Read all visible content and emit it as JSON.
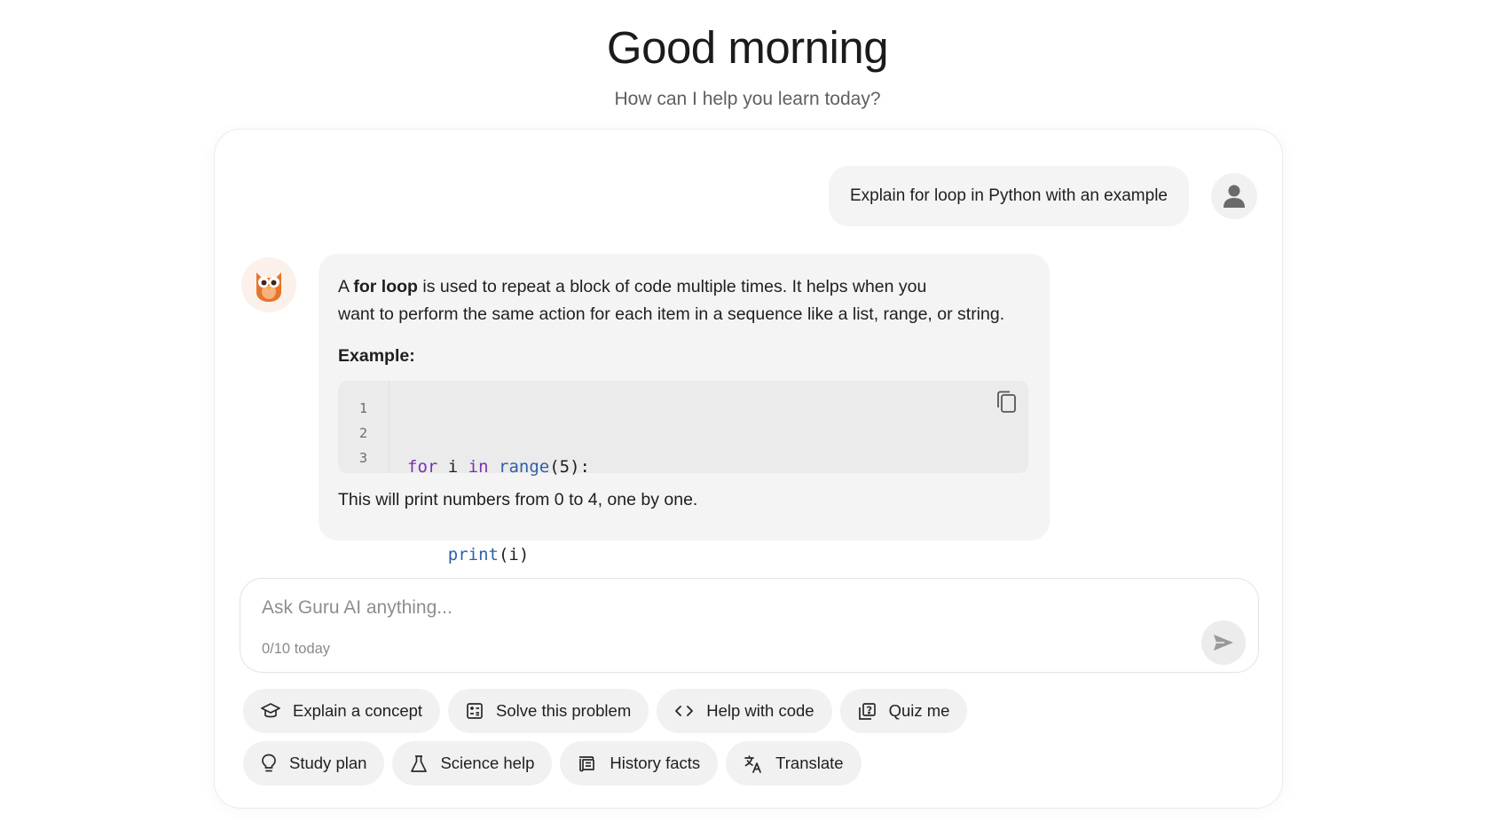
{
  "header": {
    "greeting": "Good morning",
    "subtitle": "How can I help you learn today?"
  },
  "conversation": {
    "user_message": "Explain for loop in Python with an example",
    "assistant": {
      "intro_prefix": "A ",
      "intro_bold": "for loop",
      "intro_rest_line1": " is used to repeat a block of code multiple times. It helps when you",
      "intro_line2": "want to perform the same action for each item in a sequence like a list, range, or string.",
      "example_label": "Example:",
      "code": {
        "line_numbers": [
          "1",
          "2",
          "3"
        ],
        "line1": {
          "kw1": "for",
          "t1": " i ",
          "kw2": "in",
          "t2": " ",
          "fn": "range",
          "t3": "(5):"
        },
        "line2": {
          "indent": "    ",
          "fn": "print",
          "t1": "(i)"
        }
      },
      "outro": "This will print numbers from 0 to 4, one by one."
    }
  },
  "composer": {
    "placeholder": "Ask Guru AI anything...",
    "counter": "0/10 today"
  },
  "quick_actions": {
    "row1": [
      {
        "label": "Explain a concept",
        "icon": "graduation-cap-icon"
      },
      {
        "label": "Solve this problem",
        "icon": "calculator-icon"
      },
      {
        "label": "Help with code",
        "icon": "code-icon"
      },
      {
        "label": "Quiz me",
        "icon": "quiz-icon"
      }
    ],
    "row2": [
      {
        "label": "Study plan",
        "icon": "lightbulb-icon"
      },
      {
        "label": "Science help",
        "icon": "flask-icon"
      },
      {
        "label": "History facts",
        "icon": "scroll-icon"
      },
      {
        "label": "Translate",
        "icon": "translate-icon"
      }
    ]
  },
  "colors": {
    "keyword": "#7a2fb5",
    "function": "#2f5fa8",
    "bubble_bg": "#f4f4f4",
    "owl": "#e8742c"
  }
}
